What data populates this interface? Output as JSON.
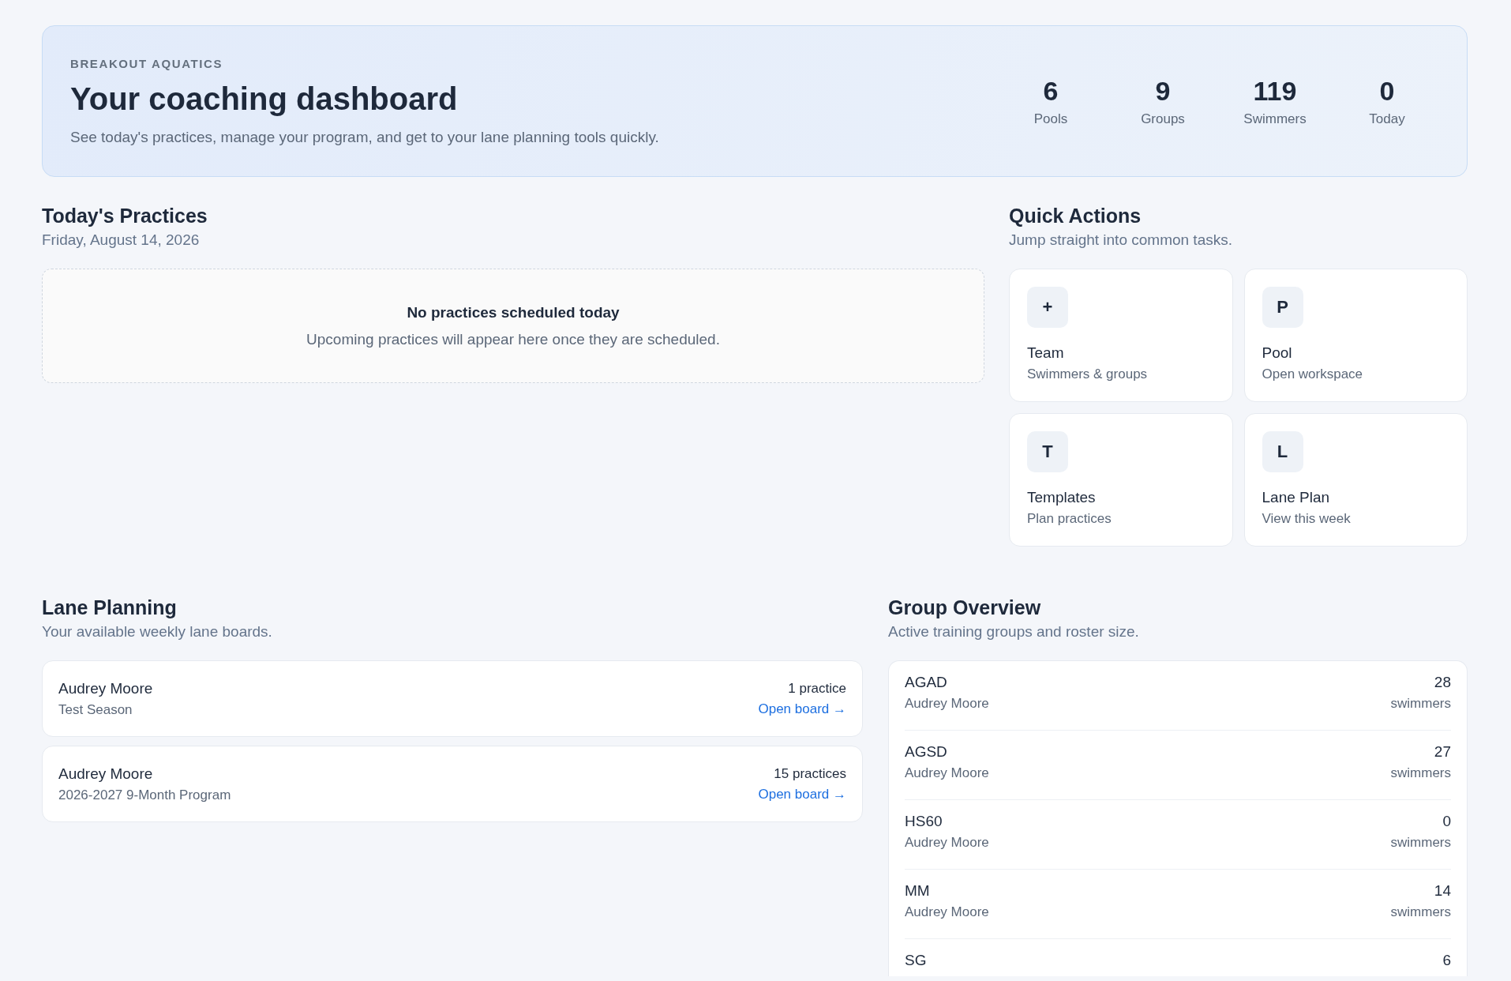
{
  "hero": {
    "eyebrow": "BREAKOUT AQUATICS",
    "title": "Your coaching dashboard",
    "subtitle": "See today's practices, manage your program, and get to your lane planning tools quickly.",
    "stats": [
      {
        "value": "6",
        "label": "Pools"
      },
      {
        "value": "9",
        "label": "Groups"
      },
      {
        "value": "119",
        "label": "Swimmers"
      },
      {
        "value": "0",
        "label": "Today"
      }
    ]
  },
  "practices": {
    "title": "Today's Practices",
    "date": "Friday, August 14, 2026",
    "empty_title": "No practices scheduled today",
    "empty_message": "Upcoming practices will appear here once they are scheduled."
  },
  "quick_actions": {
    "title": "Quick Actions",
    "subtitle": "Jump straight into common tasks.",
    "items": [
      {
        "initial": "+",
        "title": "Team",
        "subtitle": "Swimmers & groups"
      },
      {
        "initial": "P",
        "title": "Pool",
        "subtitle": "Open workspace"
      },
      {
        "initial": "T",
        "title": "Templates",
        "subtitle": "Plan practices"
      },
      {
        "initial": "L",
        "title": "Lane Plan",
        "subtitle": "View this week"
      }
    ]
  },
  "lane_planning": {
    "title": "Lane Planning",
    "subtitle": "Your available weekly lane boards.",
    "boards": [
      {
        "name": "Audrey Moore",
        "season": "Test Season",
        "count": "1 practice",
        "link": "Open board →"
      },
      {
        "name": "Audrey Moore",
        "season": "2026-2027 9-Month Program",
        "count": "15 practices",
        "link": "Open board →"
      }
    ]
  },
  "group_overview": {
    "title": "Group Overview",
    "subtitle": "Active training groups and roster size.",
    "groups": [
      {
        "name": "AGAD",
        "coach": "Audrey Moore",
        "count": "28",
        "unit": "swimmers"
      },
      {
        "name": "AGSD",
        "coach": "Audrey Moore",
        "count": "27",
        "unit": "swimmers"
      },
      {
        "name": "HS60",
        "coach": "Audrey Moore",
        "count": "0",
        "unit": "swimmers"
      },
      {
        "name": "MM",
        "coach": "Audrey Moore",
        "count": "14",
        "unit": "swimmers"
      },
      {
        "name": "SG",
        "count": "6"
      }
    ]
  }
}
